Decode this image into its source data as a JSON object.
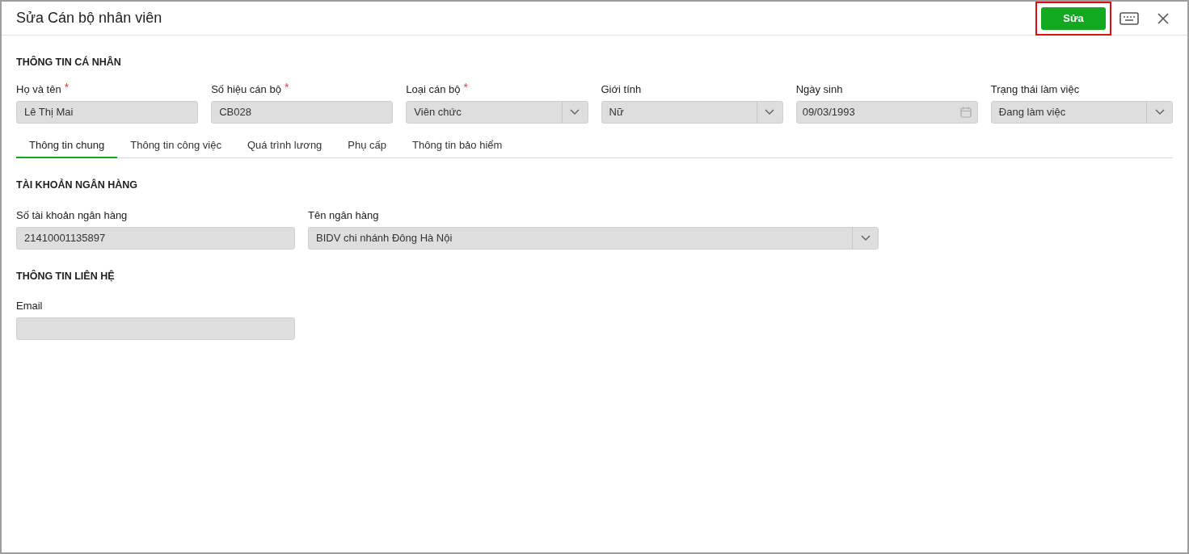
{
  "window": {
    "title": "Sửa Cán bộ nhân viên"
  },
  "header_actions": {
    "save_button": {
      "label": "Sửa",
      "highlighted": true
    }
  },
  "personal_info": {
    "heading": "THÔNG TIN CÁ NHÂN",
    "fields": [
      {
        "label": "Họ và tên",
        "required_mark": "*",
        "kind": "text",
        "value": "Lê Thị Mai"
      },
      {
        "label": "Số hiệu cán bộ",
        "required_mark": "*",
        "kind": "text",
        "value": "CB028"
      },
      {
        "label": "Loại cán bộ",
        "required_mark": "*",
        "kind": "select",
        "value": "Viên chức"
      },
      {
        "label": "Giới tính",
        "kind": "select",
        "value": "Nữ"
      },
      {
        "label": "Ngày sinh",
        "kind": "date",
        "value": "09/03/1993"
      },
      {
        "label": "Trạng thái làm việc",
        "kind": "select",
        "value": "Đang làm việc"
      }
    ]
  },
  "tabs": [
    {
      "label": "Thông tin chung",
      "selected": true
    },
    {
      "label": "Thông tin công việc",
      "selected": false
    },
    {
      "label": "Quá trình lương",
      "selected": false
    },
    {
      "label": "Phụ cấp",
      "selected": false
    },
    {
      "label": "Thông tin bảo hiểm",
      "selected": false
    }
  ],
  "bank_account": {
    "heading": "TÀI KHOẢN NGÂN HÀNG",
    "fields": [
      {
        "label": "Số tài khoản ngân hàng",
        "kind": "text",
        "value": "21410001135897"
      },
      {
        "label": "Tên ngân hàng",
        "kind": "select",
        "value": "BIDV chi nhánh Đông Hà Nội"
      }
    ]
  },
  "contact_info": {
    "heading": "THÔNG TIN LIÊN HỆ",
    "fields": [
      {
        "label": "Email",
        "kind": "text"
      }
    ]
  }
}
